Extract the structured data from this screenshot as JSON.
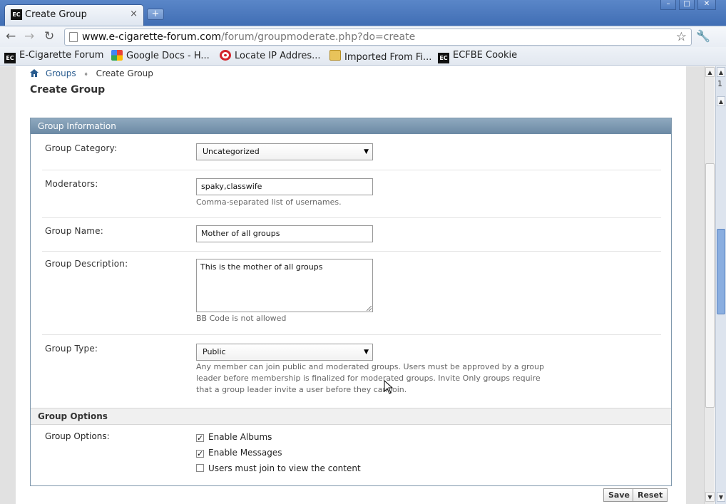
{
  "browser": {
    "tab_title": "Create Group",
    "tab_close": "×",
    "new_tab": "+",
    "url_host": "www.e-cigarette-forum.com",
    "url_path": "/forum/groupmoderate.php?do=create",
    "bookmarks": [
      {
        "label": "E-Cigarette Forum",
        "icon": "ecf-icon"
      },
      {
        "label": "Google Docs - H...",
        "icon": "google-docs-icon"
      },
      {
        "label": "Locate IP Addres...",
        "icon": "target-icon"
      },
      {
        "label": "Imported From Fi...",
        "icon": "folder-icon"
      },
      {
        "label": "ECFBE Cookie",
        "icon": "ecf-icon"
      }
    ]
  },
  "breadcrumb": {
    "home_icon": "home-icon",
    "link": "Groups",
    "current": "Create Group"
  },
  "page_title": "Create Group",
  "panel": {
    "title": "Group Information",
    "category": {
      "label": "Group Category:",
      "value": "Uncategorized"
    },
    "moderators": {
      "label": "Moderators:",
      "value": "spaky,classwife",
      "help": "Comma-separated list of usernames."
    },
    "name": {
      "label": "Group Name:",
      "value": "Mother of all groups"
    },
    "description": {
      "label": "Group Description:",
      "value": "This is the mother of all groups",
      "help": "BB Code is not allowed"
    },
    "type": {
      "label": "Group Type:",
      "value": "Public",
      "help": "Any member can join public and moderated groups. Users must be approved by a group leader before membership is finalized for moderated groups. Invite Only groups require that a group leader invite a user before they can join."
    },
    "options_header": "Group Options",
    "options_label": "Group Options:",
    "options": [
      {
        "label": "Enable Albums",
        "checked": true
      },
      {
        "label": "Enable Messages",
        "checked": true
      },
      {
        "label": "Users must join to view the content",
        "checked": false
      }
    ]
  },
  "buttons": {
    "save": "Save",
    "reset": "Reset"
  },
  "outer_scroll_number": "1",
  "colors": {
    "link": "#2a5c8f",
    "panel_header": "#7a96af",
    "chrome_blue": "#4a78bd"
  }
}
